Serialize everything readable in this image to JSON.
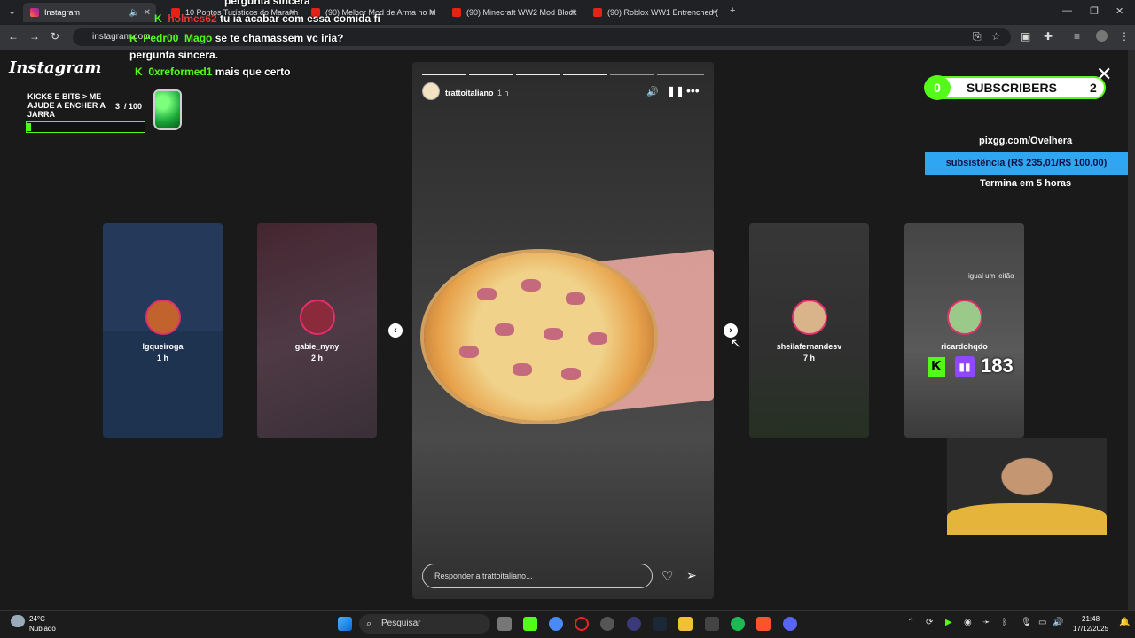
{
  "browser": {
    "tabs": [
      {
        "label": "Instagram",
        "icon": "instagram-icon",
        "active": true
      },
      {
        "label": "10 Pontos Turísticos do Maranh",
        "icon": "youtube-icon"
      },
      {
        "label": "(90) Melhor Mod de Arma no M",
        "icon": "youtube-icon"
      },
      {
        "label": "(90) Minecraft WW2 Mod Block",
        "icon": "youtube-icon"
      },
      {
        "label": "(90) Roblox WW1 Entrenched (",
        "icon": "youtube-icon"
      }
    ],
    "address": "instagram.com"
  },
  "chat": [
    {
      "user": "",
      "message": "pergunta sincera"
    },
    {
      "user": "holmes62",
      "message": "tu ia acabar com essa comida fi"
    },
    {
      "user": "Pedr00_Mago",
      "message": "se te chamassem vc iria? pergunta sincera."
    },
    {
      "user": "0xreformed1",
      "message": "mais que certo"
    }
  ],
  "instagram": {
    "logo": "Instagram",
    "story": {
      "user": "trattoitaliano",
      "time": "1 h",
      "reply_placeholder": "Responder a trattoitaliano..."
    },
    "side_stories": [
      {
        "user": "lgqueiroga",
        "time": "1 h"
      },
      {
        "user": "gabie_nyny",
        "time": "2 h"
      },
      {
        "user": "sheilafernandesv",
        "time": "7 h"
      },
      {
        "user": "ricardohqdo",
        "time": "",
        "caption": "igual um leitão"
      }
    ]
  },
  "overlay": {
    "jar": {
      "title": "KICKS E BITS > ME AJUDE A ENCHER A JARRA",
      "current": "3",
      "goal": "/ 100",
      "progress": 0.03
    },
    "subs": {
      "count": "0",
      "label": "SUBSCRIBERS",
      "goal": "2"
    },
    "pix": {
      "url": "pixgg.com/Ovelhera",
      "bar": "subsistência (R$ 235,01/R$ 100,00)",
      "ends": "Termina em 5 horas"
    },
    "viewers": "183"
  },
  "taskbar": {
    "weather_temp": "24°C",
    "weather_desc": "Nublado",
    "search": "Pesquisar",
    "time": "21:48",
    "date": "17/12/2025"
  },
  "colors": {
    "kick_green": "#53fc18",
    "twitch_purple": "#9146ff",
    "pix_blue": "#2ea6f2"
  }
}
